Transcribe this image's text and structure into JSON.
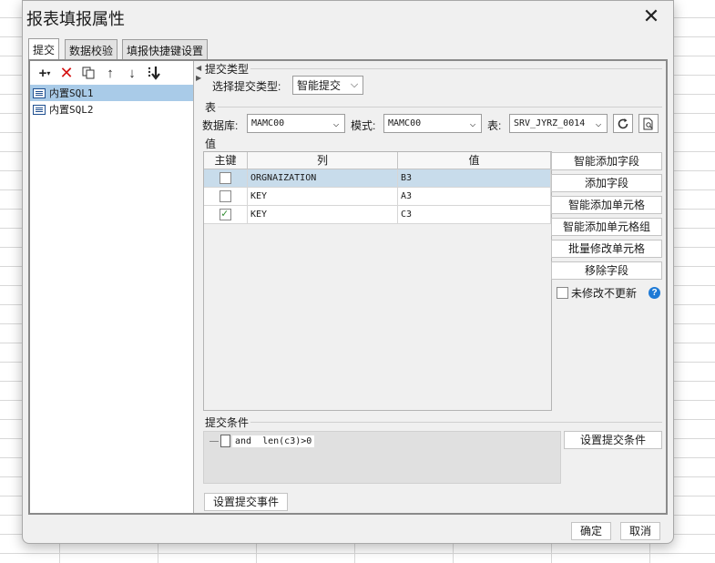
{
  "window": {
    "title": "报表填报属性"
  },
  "tabs": [
    {
      "label": "提交"
    },
    {
      "label": "数据校验"
    },
    {
      "label": "填报快捷键设置"
    }
  ],
  "toolbar": {
    "icons": [
      "add-icon",
      "delete-icon",
      "copy-icon",
      "move-up-icon",
      "move-down-icon",
      "move-bottom-icon"
    ],
    "add_dropdown": "▾"
  },
  "tree": {
    "items": [
      {
        "label": "内置SQL1",
        "selected": true
      },
      {
        "label": "内置SQL2",
        "selected": false
      }
    ]
  },
  "submit_type": {
    "section_label": "提交类型",
    "field_label": "选择提交类型:",
    "value": "智能提交"
  },
  "table_section": {
    "section_label": "表",
    "database_label": "数据库:",
    "database_value": "MAMC00",
    "schema_label": "模式:",
    "schema_value": "MAMC00",
    "table_label": "表:",
    "table_value": "SRV_JYRZ_0014"
  },
  "value_section": {
    "section_label": "值",
    "columns": [
      "主键",
      "列",
      "值"
    ],
    "rows": [
      {
        "key": false,
        "column": "ORGNAIZATION",
        "value": "B3",
        "selected": true
      },
      {
        "key": false,
        "column": "KEY",
        "value": "A3",
        "selected": false
      },
      {
        "key": true,
        "column": "KEY",
        "value": "C3",
        "selected": false
      }
    ]
  },
  "side_buttons": {
    "smart_add_field": "智能添加字段",
    "add_field": "添加字段",
    "smart_add_cell": "智能添加单元格",
    "smart_add_cell_group": "智能添加单元格组",
    "batch_modify_cell": "批量修改单元格",
    "remove_field": "移除字段",
    "unmodified_no_update": "未修改不更新",
    "help": "?"
  },
  "condition": {
    "section_label": "提交条件",
    "expression": "and  len(c3)>0",
    "set_button": "设置提交条件"
  },
  "events": {
    "set_button": "设置提交事件"
  },
  "footer": {
    "ok": "确定",
    "cancel": "取消"
  },
  "colors": {
    "selection": "#a9cbe8",
    "help": "#1e7ad6",
    "delete": "#d41414"
  }
}
